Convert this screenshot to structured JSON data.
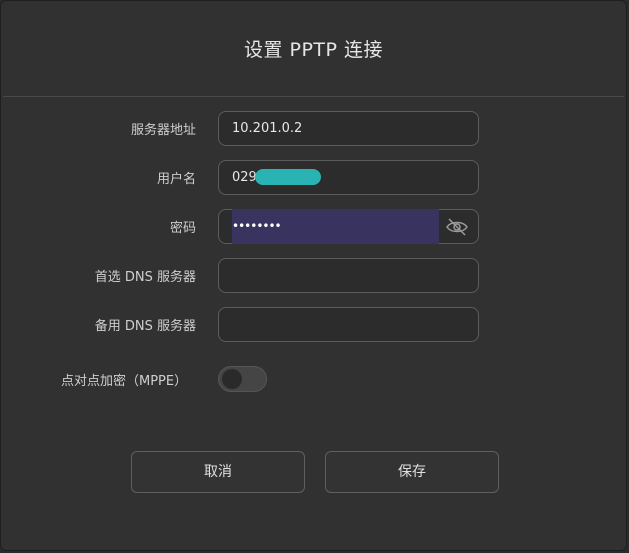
{
  "dialog": {
    "title": "设置 PPTP 连接"
  },
  "form": {
    "server": {
      "label": "服务器地址",
      "value": "10.201.0.2"
    },
    "username": {
      "label": "用户名",
      "value": "029"
    },
    "password": {
      "label": "密码",
      "value": "••••••••",
      "visibility_icon": "eye-slash-icon"
    },
    "dns_primary": {
      "label": "首选 DNS 服务器",
      "value": ""
    },
    "dns_secondary": {
      "label": "备用 DNS 服务器",
      "value": ""
    },
    "mppe": {
      "label": "点对点加密（MPPE）",
      "enabled": false
    }
  },
  "buttons": {
    "cancel": "取消",
    "save": "保存"
  },
  "colors": {
    "background": "#313131",
    "redaction": "#2ab3b3",
    "password_selection": "#39335f"
  }
}
